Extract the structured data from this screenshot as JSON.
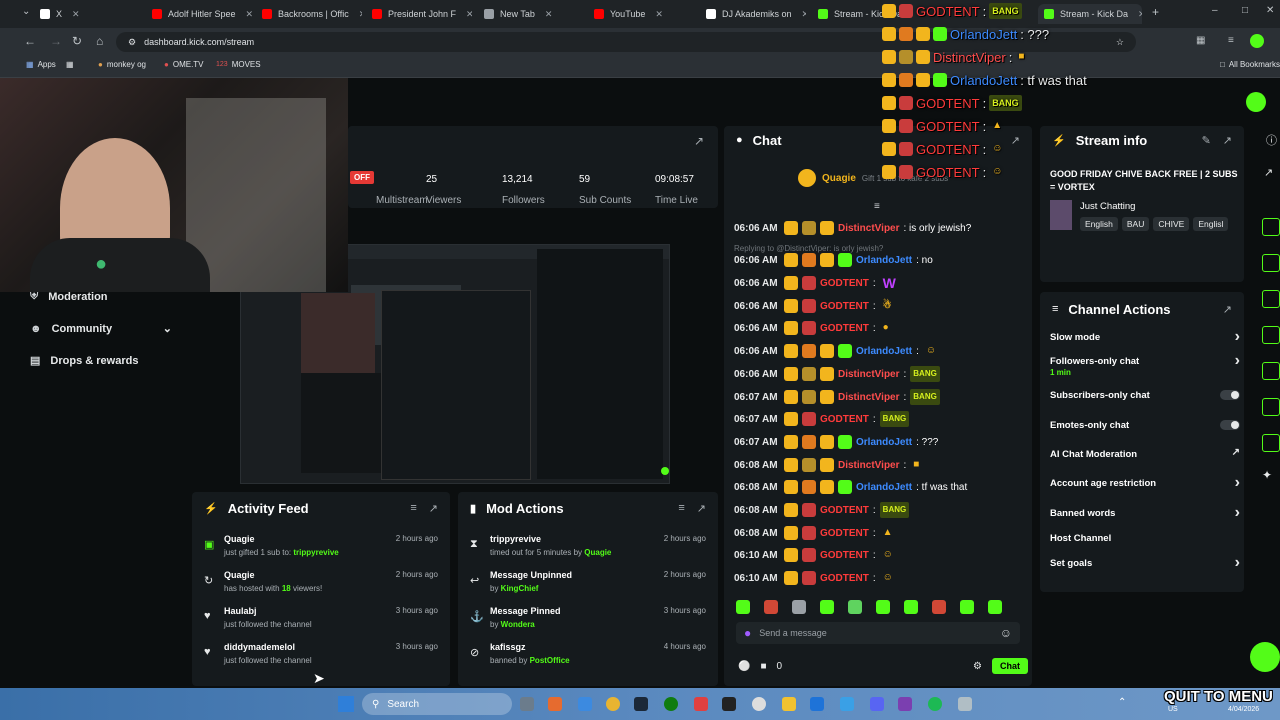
{
  "browser": {
    "tabs": [
      {
        "label": "X",
        "color": "#ffffff"
      },
      {
        "label": "Adolf Hitler Spee",
        "color": "#ff0000"
      },
      {
        "label": "Backrooms | Offic",
        "color": "#ff0000"
      },
      {
        "label": "President John F",
        "color": "#ff0000"
      },
      {
        "label": "New Tab",
        "color": "#9aa0a6"
      },
      {
        "label": "YouTube",
        "color": "#ff0000"
      },
      {
        "label": "DJ Akademiks on",
        "color": "#ffffff"
      },
      {
        "label": "Stream - Kick Da",
        "color": "#53fc18"
      },
      {
        "label": "Stream - Kick Da",
        "color": "#53fc18"
      }
    ],
    "url": "dashboard.kick.com/stream",
    "bookmarks": [
      "Apps",
      "monkey og",
      "OME.TV",
      "MOVES",
      "All Bookmarks"
    ]
  },
  "stream_header": {
    "status": "OFF",
    "multistream_label": "Multistream",
    "stats": [
      {
        "value": "25",
        "label": "Viewers"
      },
      {
        "value": "13,214",
        "label": "Followers"
      },
      {
        "value": "59",
        "label": "Sub Counts"
      },
      {
        "value": "09:08:57",
        "label": "Time Live"
      }
    ]
  },
  "sidebar": {
    "items": [
      {
        "label": "Moderation",
        "icon": "shield-icon"
      },
      {
        "label": "Community",
        "icon": "community-icon"
      },
      {
        "label": "Drops & rewards",
        "icon": "drops-icon"
      }
    ]
  },
  "activity_feed": {
    "title": "Activity Feed",
    "rows": [
      {
        "icon": "gift-icon",
        "user": "Quagie",
        "pre": "just gifted 1 sub to: ",
        "hl": "trippyrevive",
        "post": "",
        "time": "2 hours ago"
      },
      {
        "icon": "host-icon",
        "user": "Quagie",
        "pre": "has hosted with ",
        "hl": "18",
        "post": " viewers!",
        "time": "2 hours ago"
      },
      {
        "icon": "heart-icon",
        "user": "Haulabj",
        "pre": "just followed the channel",
        "hl": "",
        "post": "",
        "time": "3 hours ago"
      },
      {
        "icon": "heart-icon",
        "user": "diddymademelol",
        "pre": "just followed the channel",
        "hl": "",
        "post": "",
        "time": "3 hours ago"
      }
    ]
  },
  "mod_actions": {
    "title": "Mod Actions",
    "rows": [
      {
        "icon": "timeout-icon",
        "user": "trippyrevive",
        "pre": "timed out for 5 minutes by ",
        "hl": "Quagie",
        "post": "",
        "time": "2 hours ago"
      },
      {
        "icon": "unpin-icon",
        "user": "Message Unpinned",
        "pre": "by ",
        "hl": "KingChief",
        "post": "",
        "time": "2 hours ago"
      },
      {
        "icon": "pin-icon",
        "user": "Message Pinned",
        "pre": "by ",
        "hl": "Wondera",
        "post": "",
        "time": "3 hours ago"
      },
      {
        "icon": "ban-icon",
        "user": "kafissgz",
        "pre": "banned by ",
        "hl": "PostOffice",
        "post": "",
        "time": "4 hours ago"
      }
    ]
  },
  "chat": {
    "title": "Chat",
    "pinned_user": "Quagie",
    "pinned_text": "Gift 1 sub to kafe 2 subs",
    "reply_note": "Replying to @DistinctViper: is orly jewish?",
    "messages": [
      {
        "time": "06:06 AM",
        "user": "DistinctViper",
        "color": "#ff4d4d",
        "text": ": is orly jewish?",
        "emote": ""
      },
      {
        "time": "06:06 AM",
        "user": "OrlandoJett",
        "color": "#3d8bff",
        "text": ": no",
        "emote": ""
      },
      {
        "time": "06:06 AM",
        "user": "GODTENT",
        "color": "#ff3b3b",
        "text": ":",
        "emote": "W"
      },
      {
        "time": "06:06 AM",
        "user": "GODTENT",
        "color": "#ff3b3b",
        "text": ":",
        "emote": "☃"
      },
      {
        "time": "06:06 AM",
        "user": "GODTENT",
        "color": "#ff3b3b",
        "text": ":",
        "emote": "●"
      },
      {
        "time": "06:06 AM",
        "user": "OrlandoJett",
        "color": "#3d8bff",
        "text": ":",
        "emote": "☺"
      },
      {
        "time": "06:06 AM",
        "user": "DistinctViper",
        "color": "#ff4d4d",
        "text": ":",
        "emote": "BANG"
      },
      {
        "time": "06:07 AM",
        "user": "DistinctViper",
        "color": "#ff4d4d",
        "text": ":",
        "emote": "BANG"
      },
      {
        "time": "06:07 AM",
        "user": "GODTENT",
        "color": "#ff3b3b",
        "text": ":",
        "emote": "BANG"
      },
      {
        "time": "06:07 AM",
        "user": "OrlandoJett",
        "color": "#3d8bff",
        "text": ": ???",
        "emote": ""
      },
      {
        "time": "06:08 AM",
        "user": "DistinctViper",
        "color": "#ff4d4d",
        "text": ":",
        "emote": "■"
      },
      {
        "time": "06:08 AM",
        "user": "OrlandoJett",
        "color": "#3d8bff",
        "text": ": tf was that",
        "emote": ""
      },
      {
        "time": "06:08 AM",
        "user": "GODTENT",
        "color": "#ff3b3b",
        "text": ":",
        "emote": "BANG"
      },
      {
        "time": "06:08 AM",
        "user": "GODTENT",
        "color": "#ff3b3b",
        "text": ":",
        "emote": "▲"
      },
      {
        "time": "06:10 AM",
        "user": "GODTENT",
        "color": "#ff3b3b",
        "text": ":",
        "emote": "☺"
      },
      {
        "time": "06:10 AM",
        "user": "GODTENT",
        "color": "#ff3b3b",
        "text": ":",
        "emote": "☺"
      }
    ],
    "input_placeholder": "Send a message",
    "viewer_count": "0",
    "send_label": "Chat"
  },
  "overlay_chat": [
    {
      "user": "GODTENT",
      "color": "#ff3b3b",
      "text": ":",
      "emote": "BANG"
    },
    {
      "user": "OrlandoJett",
      "color": "#3d8bff",
      "text": ": ???",
      "emote": ""
    },
    {
      "user": "DistinctViper",
      "color": "#ff4d4d",
      "text": ":",
      "emote": "■"
    },
    {
      "user": "OrlandoJett",
      "color": "#3d8bff",
      "text": ": tf was that",
      "emote": ""
    },
    {
      "user": "GODTENT",
      "color": "#ff3b3b",
      "text": ":",
      "emote": "BANG"
    },
    {
      "user": "GODTENT",
      "color": "#ff3b3b",
      "text": ":",
      "emote": "▲"
    },
    {
      "user": "GODTENT",
      "color": "#ff3b3b",
      "text": ":",
      "emote": "☺"
    },
    {
      "user": "GODTENT",
      "color": "#ff3b3b",
      "text": ":",
      "emote": "☺"
    }
  ],
  "stream_info": {
    "title": "Stream info",
    "stream_title": "GOOD FRIDAY CHIVE BACK FREE | 2 SUBS = VORTEX",
    "category": "Just Chatting",
    "tags": [
      "English",
      "BAU",
      "CHIVE",
      "Englisl"
    ]
  },
  "channel_actions": {
    "title": "Channel Actions",
    "items": [
      {
        "label": "Slow mode",
        "sub": "",
        "control": "chevron"
      },
      {
        "label": "Followers-only chat",
        "sub": "1 min",
        "control": "chevron"
      },
      {
        "label": "Subscribers-only chat",
        "sub": "",
        "control": "toggle"
      },
      {
        "label": "Emotes-only chat",
        "sub": "",
        "control": "toggle"
      },
      {
        "label": "AI Chat Moderation",
        "sub": "",
        "control": "external"
      },
      {
        "label": "Account age restriction",
        "sub": "",
        "control": "chevron"
      },
      {
        "label": "Banned words",
        "sub": "",
        "control": "chevron"
      },
      {
        "label": "Host Channel",
        "sub": "",
        "control": "none"
      },
      {
        "label": "Set goals",
        "sub": "",
        "control": "chevron"
      }
    ]
  },
  "taskbar": {
    "search_label": "Search",
    "region": "US",
    "date": "4/04/2026",
    "watermark": "QUIT TO MENU"
  },
  "colors": {
    "kick_green": "#53fc18",
    "panel": "#151a1d",
    "background": "#0b0e0f"
  }
}
